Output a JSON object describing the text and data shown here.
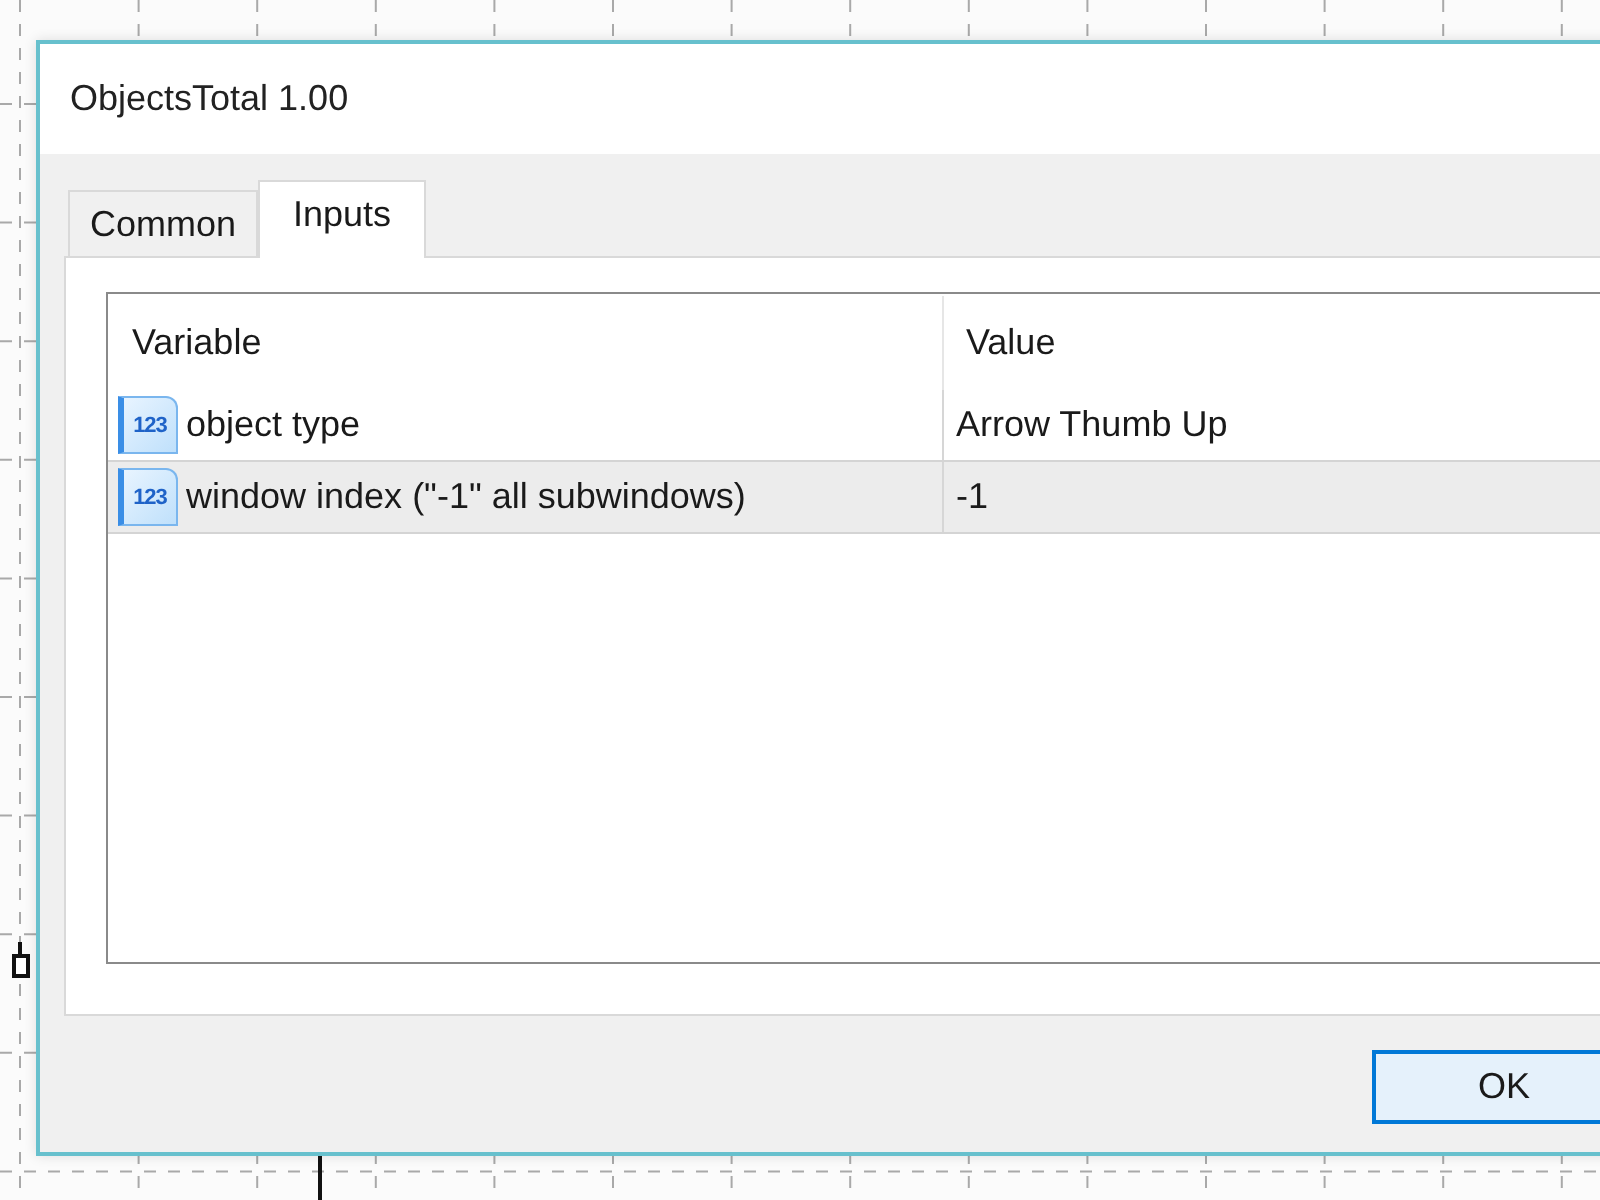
{
  "window": {
    "title": "ObjectsTotal 1.00"
  },
  "tabs": [
    {
      "label": "Common",
      "selected": false
    },
    {
      "label": "Inputs",
      "selected": true
    }
  ],
  "table": {
    "columns": [
      "Variable",
      "Value"
    ],
    "rows": [
      {
        "icon_text": "123",
        "variable": "object type",
        "value": "Arrow Thumb Up",
        "selected": false
      },
      {
        "icon_text": "123",
        "variable": "window index (\"-1\" all subwindows)",
        "value": "-1",
        "selected": true
      }
    ]
  },
  "buttons": [
    {
      "label": "OK",
      "default": true
    }
  ]
}
